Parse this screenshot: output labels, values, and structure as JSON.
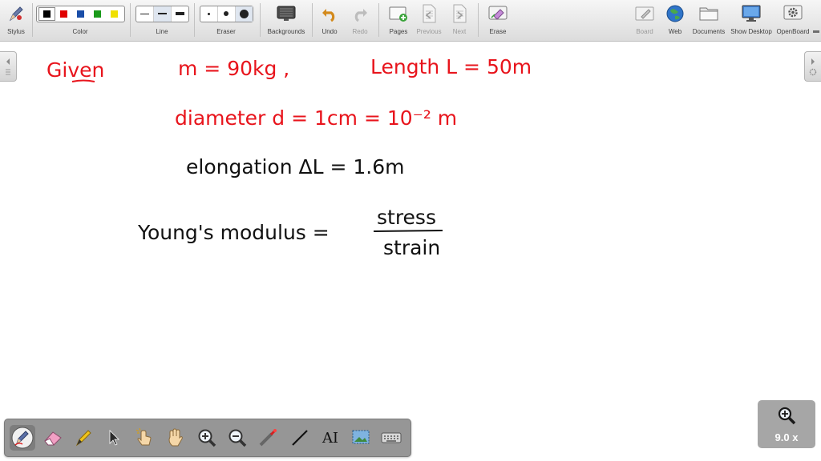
{
  "toolbar": {
    "stylus": "Stylus",
    "color": "Color",
    "line": "Line",
    "eraser": "Eraser",
    "backgrounds": "Backgrounds",
    "undo": "Undo",
    "redo": "Redo",
    "pages": "Pages",
    "previous": "Previous",
    "next": "Next",
    "erase": "Erase",
    "board": "Board",
    "web": "Web",
    "documents": "Documents",
    "show_desktop": "Show Desktop",
    "openboard": "OpenBoard"
  },
  "palette_colors": [
    "#000000",
    "#e00000",
    "#1a4ea8",
    "#1a9a1a",
    "#f0e000"
  ],
  "ink_colors": {
    "red": "#e8141c",
    "black": "#111111"
  },
  "board_text": {
    "given": "Given",
    "mass": "m = 90kg ,",
    "length": "Length L = 50m",
    "diameter": "diameter d = 1cm = 10⁻² m",
    "elongation": "elongation ΔL = 1.6m",
    "youngs": "Young's modulus =",
    "numerator": "stress",
    "denominator": "strain"
  },
  "bottom_tools": [
    "pen-icon",
    "eraser-icon",
    "marker-icon",
    "pointer-icon",
    "hand-pointer-icon",
    "hand-icon",
    "zoom-in-icon",
    "zoom-out-icon",
    "laser-pointer-icon",
    "line-icon",
    "text-icon",
    "capture-icon",
    "keyboard-icon"
  ],
  "text_tool_label": "AI",
  "zoom": {
    "label": "9.0 x"
  }
}
